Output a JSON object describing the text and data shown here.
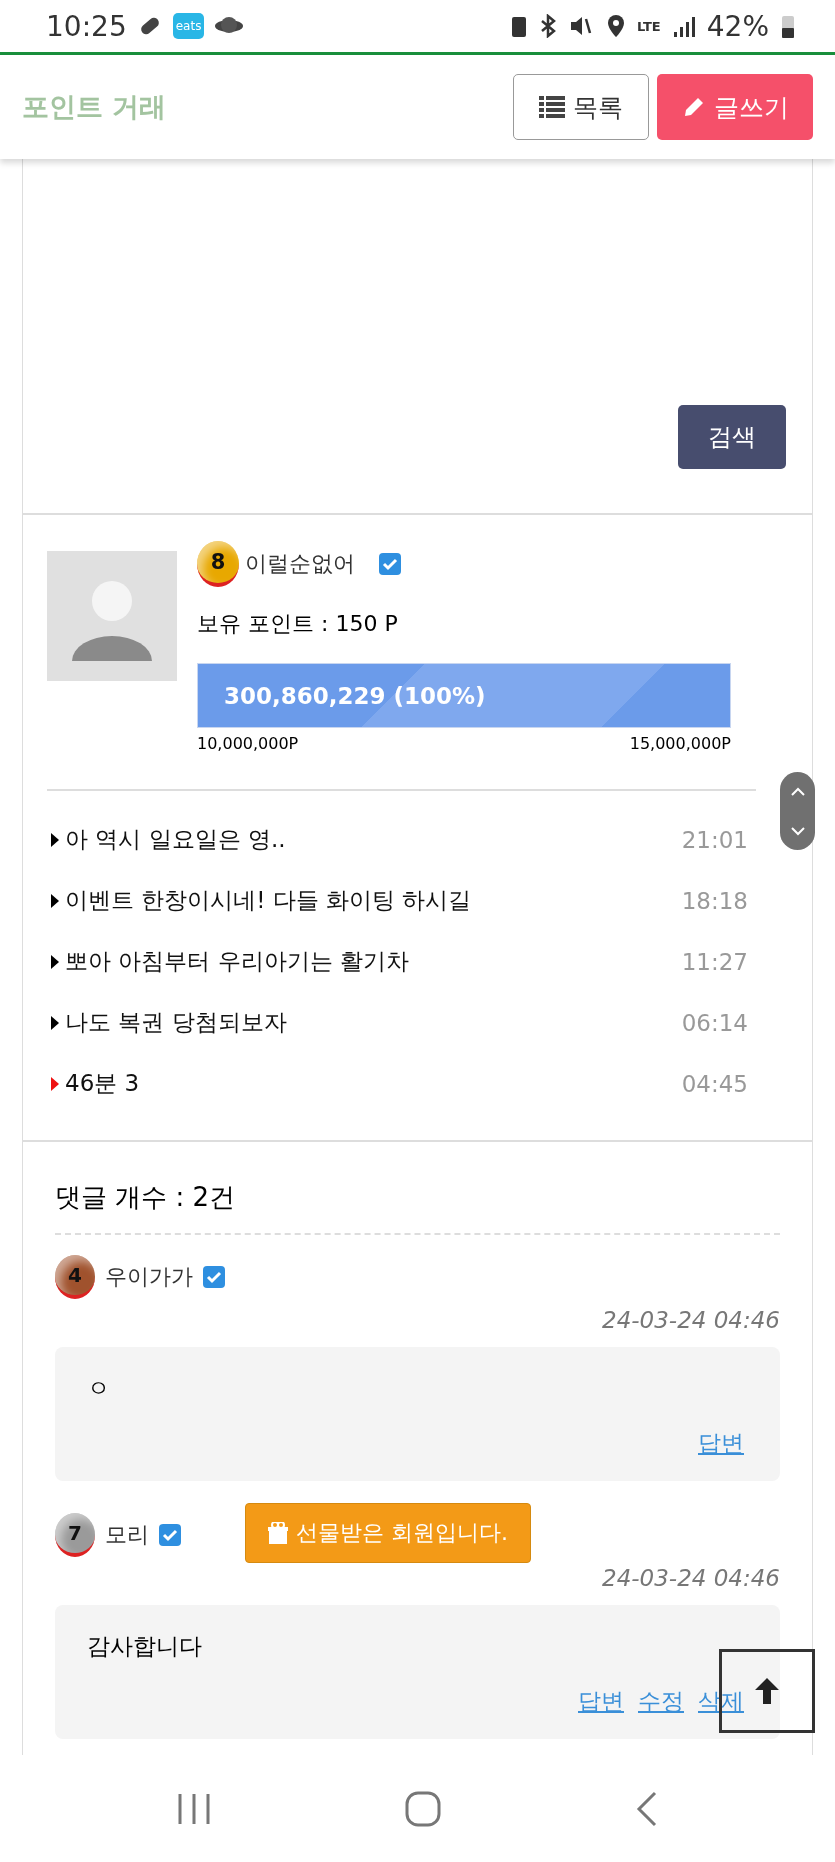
{
  "status_bar": {
    "time": "10:25",
    "app_badge": "eats",
    "network": "LTE",
    "battery": "42%"
  },
  "header": {
    "title": "포인트 거래",
    "buttons": [
      {
        "kind": "list",
        "label": "목록"
      },
      {
        "kind": "write",
        "label": "글쓰기"
      }
    ]
  },
  "search": {
    "button": "검색"
  },
  "profile": {
    "level": "8",
    "name": "이럴순없어",
    "points": "보유 포인트 : 150 P",
    "progress": {
      "level": 1,
      "label": "300,860,229 (100%)",
      "min": "10,000,000P",
      "max": "15,000,000P"
    }
  },
  "posts": [
    {
      "title": "아 역시 일요일은 영..",
      "time": "21:01",
      "color": "#000000"
    },
    {
      "title": "이벤트 한창이시네! 다들 화이팅 하시길",
      "time": "18:18",
      "color": "#000000"
    },
    {
      "title": "뽀아 아침부터 우리아기는 활기차",
      "time": "11:27",
      "color": "#000000"
    },
    {
      "title": "나도 복권 당첨되보자",
      "time": "06:14",
      "color": "#000000"
    },
    {
      "title": "46분 3",
      "time": "04:45",
      "color": "#ee1111"
    }
  ],
  "comments": {
    "count": "댓글 개수 : 2건",
    "items": [
      {
        "level": "4",
        "color": "#a0522d",
        "author": "우이가가",
        "date": "24-03-24 04:46",
        "text": "ㅇ",
        "actions": [
          "답변"
        ]
      },
      {
        "level": "7",
        "color": "#9a9a9a",
        "author": "모리",
        "date": "24-03-24 04:46",
        "text": "감사합니다",
        "actions": [
          "답변",
          "수정",
          "삭제"
        ],
        "tooltip": "선물받은 회원입니다."
      }
    ]
  }
}
